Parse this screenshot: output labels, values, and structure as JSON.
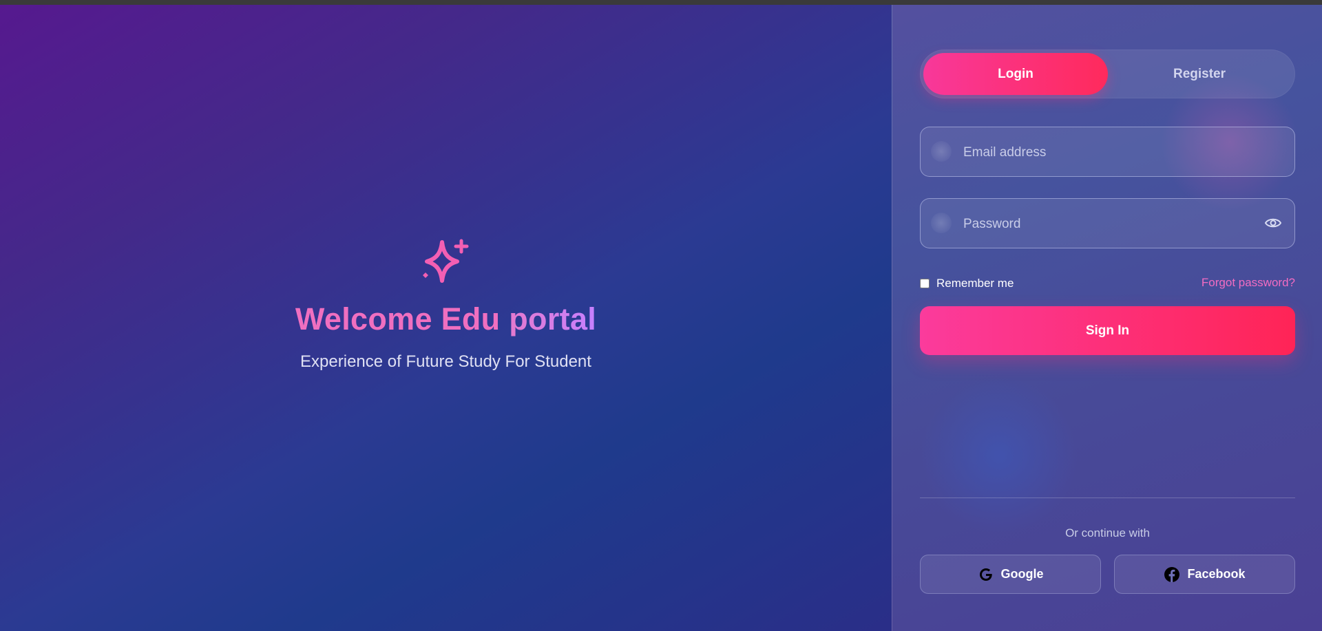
{
  "hero": {
    "title_part1": "Welcome Edu",
    "title_part2": " portal",
    "subtitle": "Experience of Future Study For Student",
    "icon": "sparkles-icon"
  },
  "auth": {
    "tabs": [
      {
        "label": "Login",
        "active": true
      },
      {
        "label": "Register",
        "active": false
      }
    ],
    "email": {
      "placeholder": "Email address",
      "value": ""
    },
    "password": {
      "placeholder": "Password",
      "value": ""
    },
    "remember_label": "Remember me",
    "forgot_label": "Forgot password?",
    "signin_label": "Sign In",
    "continue_label": "Or continue with",
    "social": [
      {
        "label": "Google",
        "icon": "google-icon"
      },
      {
        "label": "Facebook",
        "icon": "facebook-icon"
      }
    ]
  },
  "colors": {
    "accent_pink": "#ff2a6f",
    "title_gradient_start": "#f06fc0",
    "title_gradient_end": "#c27dff",
    "link": "#f36cc2"
  }
}
